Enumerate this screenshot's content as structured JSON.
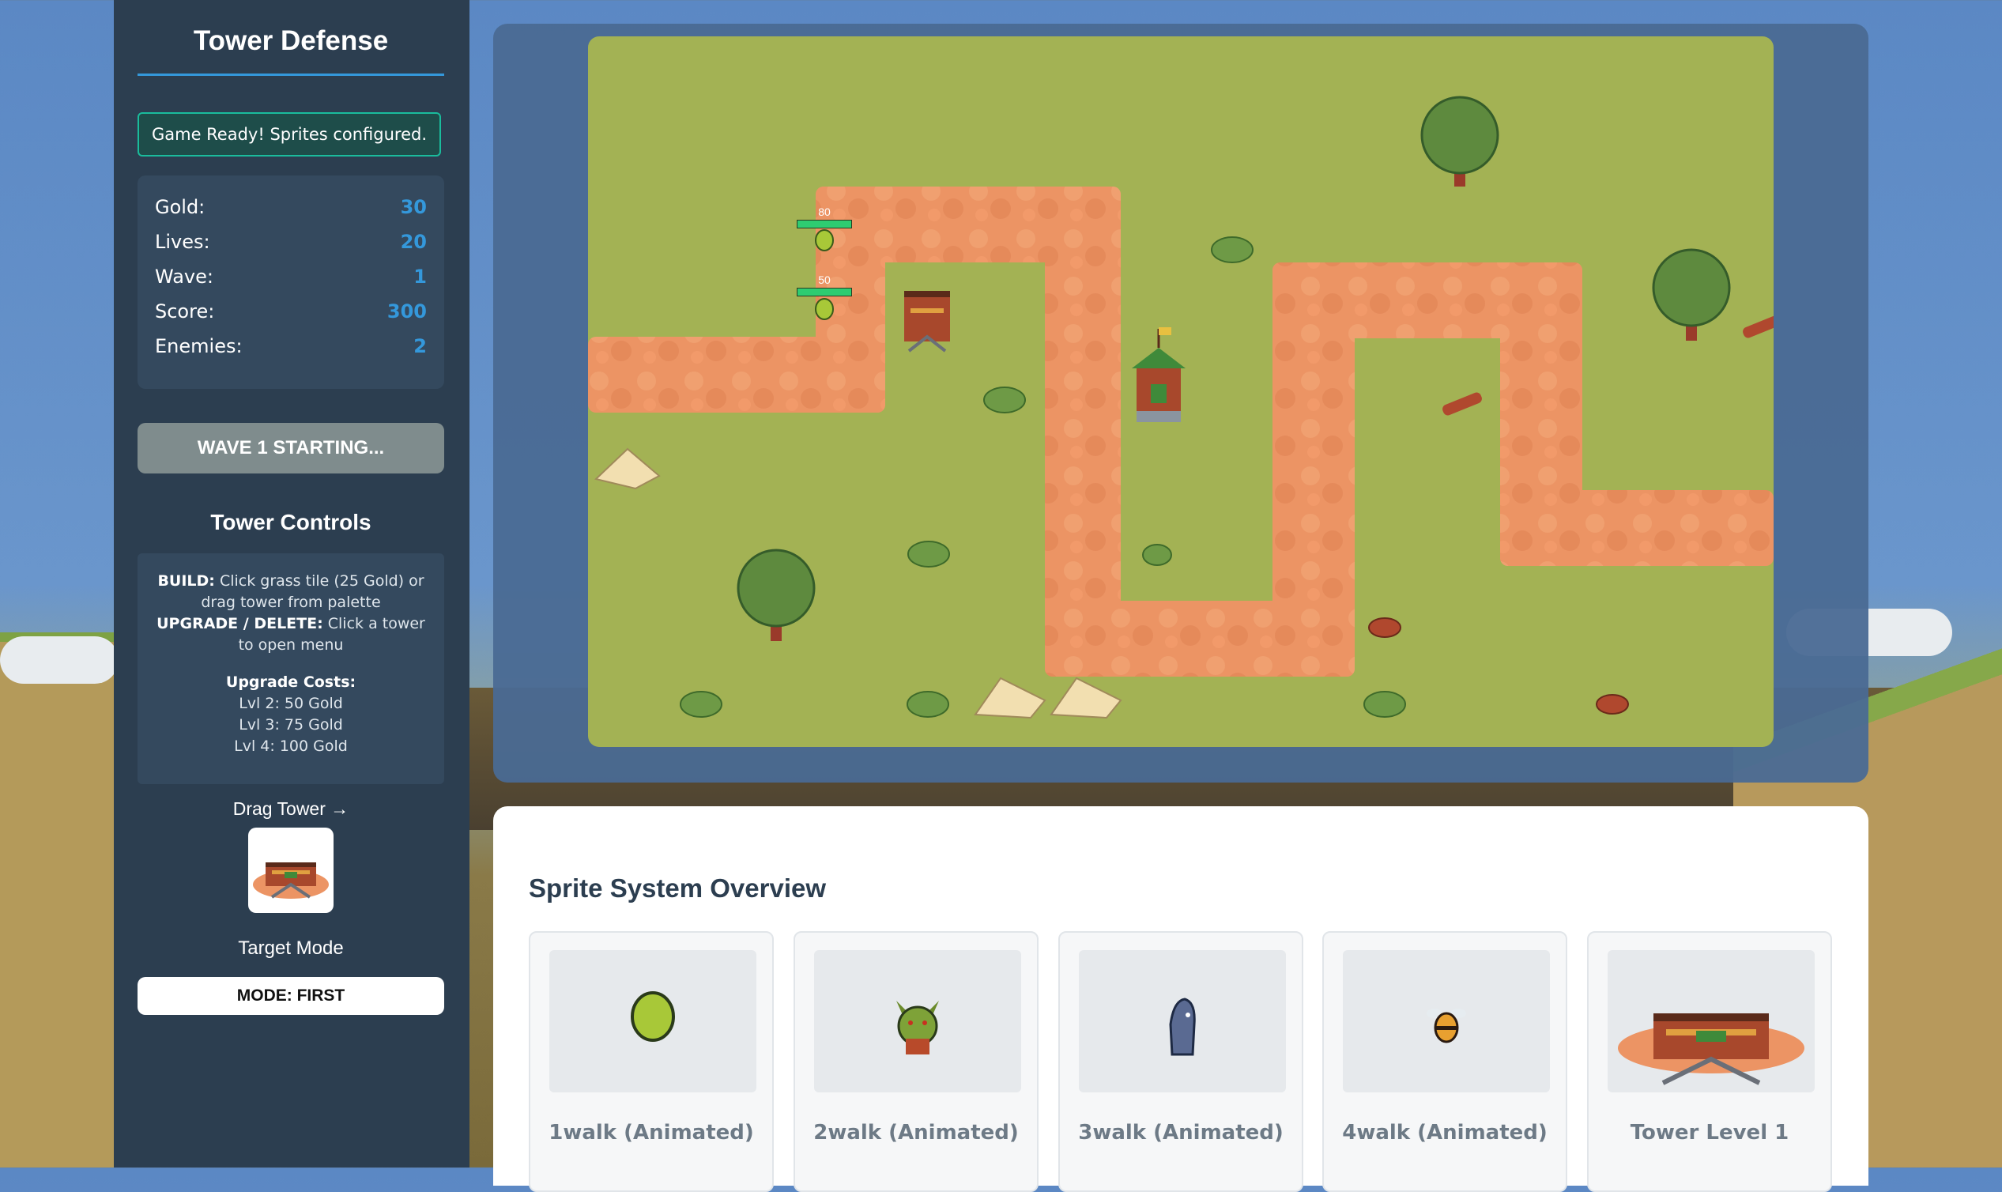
{
  "sidebar": {
    "title": "Tower Defense",
    "status": "Game Ready! Sprites configured.",
    "stats": [
      {
        "label": "Gold:",
        "value": "30"
      },
      {
        "label": "Lives:",
        "value": "20"
      },
      {
        "label": "Wave:",
        "value": "1"
      },
      {
        "label": "Score:",
        "value": "300"
      },
      {
        "label": "Enemies:",
        "value": "2"
      }
    ],
    "wave_button": "WAVE 1 STARTING...",
    "controls_title": "Tower Controls",
    "help": {
      "build_label": "BUILD:",
      "build_text": "Click grass tile (25 Gold) or drag tower from palette",
      "upgrade_label": "UPGRADE / DELETE:",
      "upgrade_text": "Click a tower to open menu",
      "costs_title": "Upgrade Costs:",
      "costs": [
        "Lvl 2: 50 Gold",
        "Lvl 3: 75 Gold",
        "Lvl 4: 100 Gold"
      ]
    },
    "drag_label": "Drag Tower →",
    "target_label": "Target Mode",
    "mode_button": "MODE: FIRST"
  },
  "board": {
    "enemy_hp": [
      {
        "text": "80",
        "fraction": 1.0
      },
      {
        "text": "50",
        "fraction": 1.0
      }
    ]
  },
  "overview": {
    "title": "Sprite System Overview",
    "cards": [
      {
        "label": "1walk (Animated)",
        "icon": "green-slime-icon"
      },
      {
        "label": "2walk (Animated)",
        "icon": "goblin-icon"
      },
      {
        "label": "3walk (Animated)",
        "icon": "hooded-bird-icon"
      },
      {
        "label": "4walk (Animated)",
        "icon": "bee-icon"
      },
      {
        "label": "Tower Level 1",
        "icon": "tower-icon"
      }
    ]
  },
  "colors": {
    "sidebar_bg": "#2c3e50",
    "accent": "#3498db",
    "grass": "#a3b254",
    "path": "#ec9464"
  }
}
